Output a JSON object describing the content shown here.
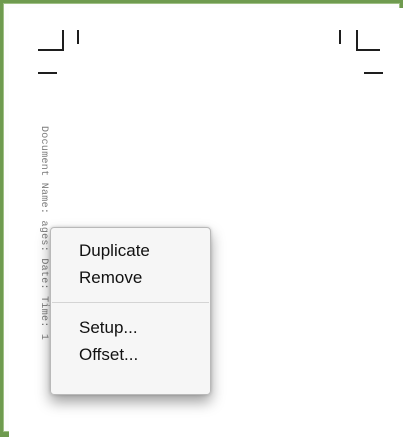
{
  "document": {
    "slug_line": "Document Name: ages: Date: Time: 1"
  },
  "context_menu": {
    "items": [
      {
        "label": "Duplicate"
      },
      {
        "label": "Remove"
      },
      {
        "label": "Setup..."
      },
      {
        "label": "Offset..."
      }
    ]
  },
  "colors": {
    "frame_border": "#6f9b4f",
    "page_background": "#ffffff",
    "menu_background": "#f6f6f6",
    "menu_text": "#111111",
    "slug_text": "#7c7c7c"
  }
}
